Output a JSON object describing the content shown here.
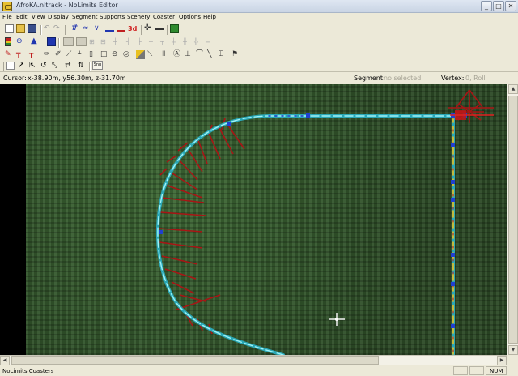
{
  "window": {
    "title": "AfroKA.nltrack - NoLimits Editor"
  },
  "menu": [
    "File",
    "Edit",
    "View",
    "Display",
    "Segment",
    "Supports",
    "Scenery",
    "Coaster",
    "Options",
    "Help"
  ],
  "toolbar": {
    "3d_label": "3d",
    "snp_label": "Snp"
  },
  "info": {
    "cursor_label": "Cursor:",
    "cursor_value": "x-38.90m, y56.30m, z-31.70m",
    "segment_label": "Segment:",
    "segment_value": "no selected",
    "vertex_label": "Vertex:",
    "vertex_value": "0, Roll"
  },
  "status": {
    "text": "NoLimits Coasters",
    "num": "NUM"
  },
  "colors": {
    "grass": "#33552b",
    "track_rail": "#36c6d2",
    "support": "#b01818",
    "vertex": "#2040d0",
    "chain": "#e8c020"
  }
}
